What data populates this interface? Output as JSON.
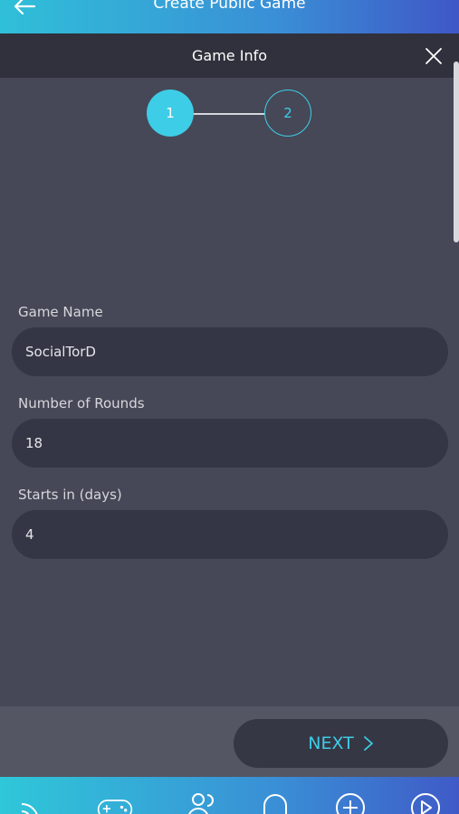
{
  "appbar": {
    "title": "Create Public Game",
    "back_icon": "arrow-left-icon"
  },
  "modal": {
    "title": "Game Info",
    "close_icon": "close-icon"
  },
  "stepper": {
    "steps": [
      "1",
      "2"
    ],
    "active": 1
  },
  "form": {
    "game_name": {
      "label": "Game Name",
      "value": "SocialTorD"
    },
    "rounds": {
      "label": "Number of Rounds",
      "value": "18"
    },
    "starts": {
      "label": "Starts in (days)",
      "value": "4"
    }
  },
  "footer": {
    "next_label": "NEXT",
    "next_icon": "chevron-right-icon"
  },
  "bottom_nav": {
    "items": [
      "feed-icon",
      "gamepad-icon",
      "friends-icon",
      "notifications-icon",
      "add-icon",
      "play-icon"
    ]
  },
  "colors": {
    "accent": "#3ecde6",
    "background": "#464857",
    "field": "#353645"
  }
}
